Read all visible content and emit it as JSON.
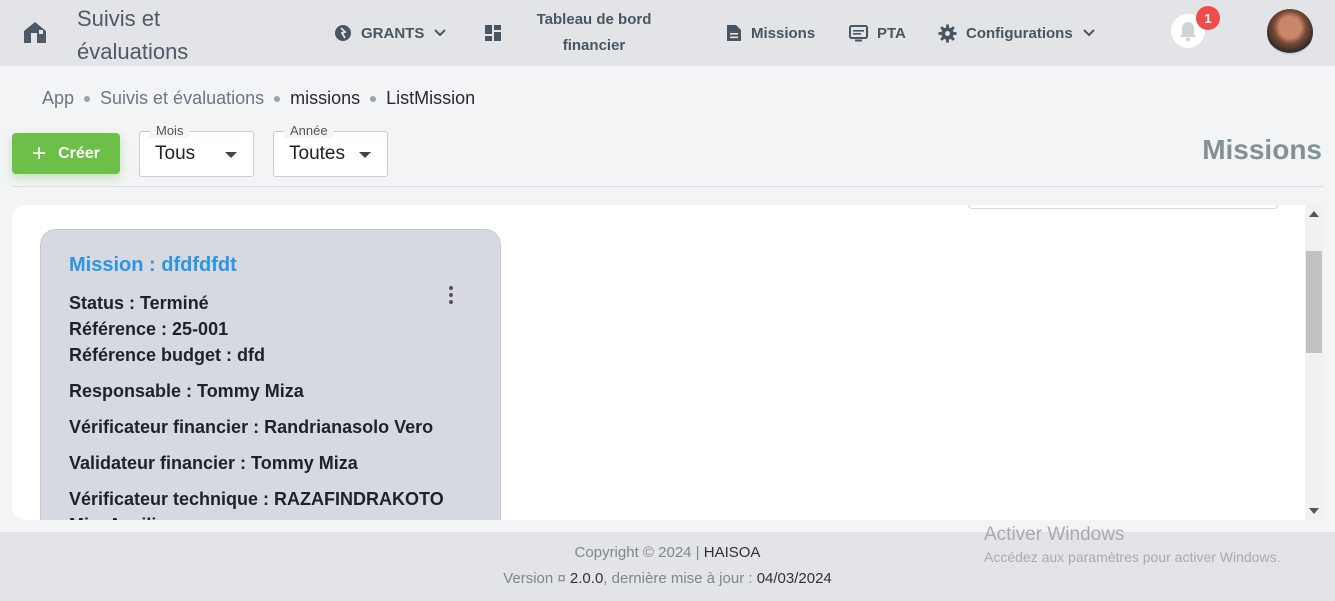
{
  "app": {
    "title": "Suivis et évaluations"
  },
  "nav": {
    "grants": "GRANTS",
    "dashboard_line1": "Tableau de bord",
    "dashboard_line2": "financier",
    "missions": "Missions",
    "pta": "PTA",
    "configurations": "Configurations"
  },
  "notifications": {
    "count": "1"
  },
  "breadcrumb": [
    "App",
    "Suivis et évaluations",
    "missions",
    "ListMission"
  ],
  "toolbar": {
    "create_label": "Créer",
    "mois": {
      "legend": "Mois",
      "value": "Tous"
    },
    "annee": {
      "legend": "Année",
      "value": "Toutes"
    },
    "heading": "Missions"
  },
  "missions": [
    {
      "title": "Mission : dfdfdfdt",
      "status": "Status : Terminé",
      "reference": "Référence : 25-001",
      "reference_budget": "Référence budget : dfd",
      "responsable": "Responsable : Tommy Miza",
      "verificateur_financier": "Vérificateur financier : Randrianasolo Vero",
      "validateur_financier": "Validateur financier : Tommy Miza",
      "verificateur_technique": "Vérificateur technique : RAZAFINDRAKOTO",
      "cut_line": "Mi... A... ili..."
    }
  ],
  "footer": {
    "copyright_prefix": "Copyright © 2024 |",
    "company": "HAISOA",
    "version_prefix": "Version ¤",
    "version": "2.0.0",
    "update_prefix": ", dernière mise à jour :",
    "update_date": "04/03/2024"
  },
  "watermark": {
    "line1": "Activer Windows",
    "line2": "Accédez aux paramètres pour activer Windows."
  },
  "colors": {
    "accent_green": "#6cc04a",
    "link_blue": "#2b95e6",
    "badge_red": "#f24b4b"
  }
}
